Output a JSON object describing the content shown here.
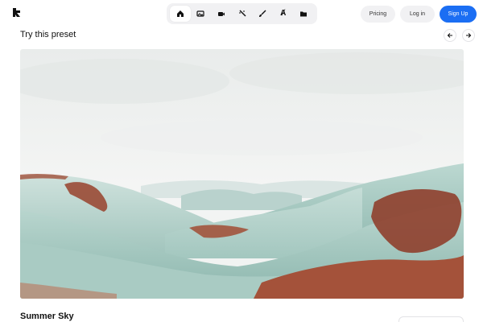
{
  "header": {
    "logo_icon": "brand-logo-icon",
    "tools": [
      {
        "icon": "home-icon",
        "active": true
      },
      {
        "icon": "image-icon",
        "active": false
      },
      {
        "icon": "video-icon",
        "active": false
      },
      {
        "icon": "magic-wand-icon",
        "active": false
      },
      {
        "icon": "brush-icon",
        "active": false
      },
      {
        "icon": "text-icon",
        "active": false
      },
      {
        "icon": "folder-icon",
        "active": false
      }
    ],
    "text_tool_glyph": "Ⱥ",
    "pricing_label": "Pricing",
    "login_label": "Log in",
    "signup_label": "Sign Up"
  },
  "main": {
    "section_title": "Try this preset",
    "prev_icon": "arrow-left-icon",
    "next_icon": "arrow-right-icon",
    "preset_name": "Summer Sky"
  },
  "colors": {
    "accent": "#1b6ef3",
    "pill_background": "#f1f1f3",
    "hill_teal": "#b5d3cc",
    "foliage_rust": "#9a4a35"
  }
}
